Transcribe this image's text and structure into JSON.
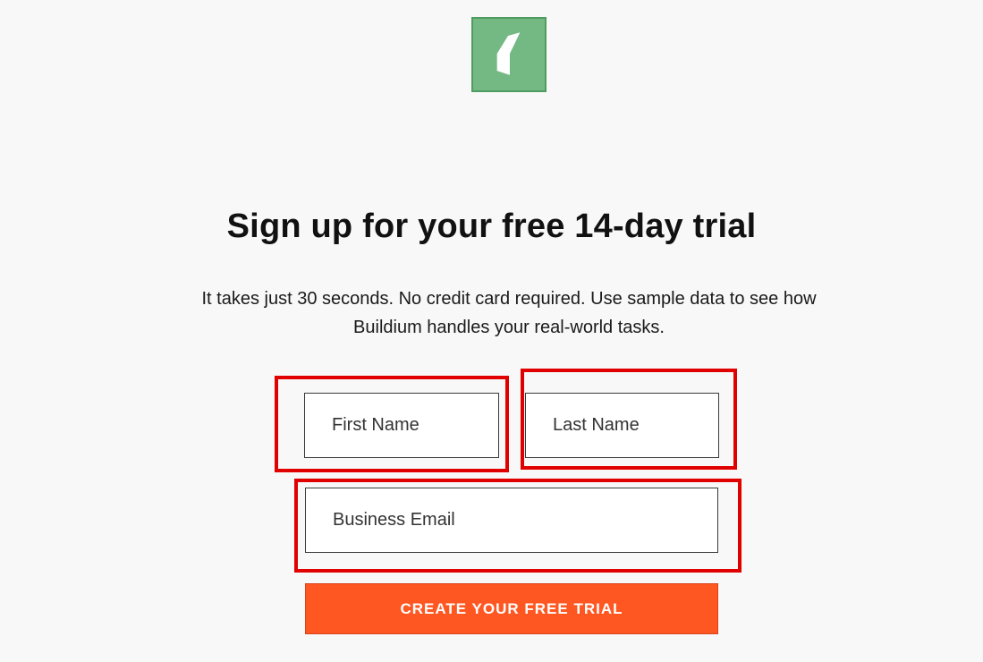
{
  "theme": {
    "brand_color": "#74b983",
    "accent_color": "#ff5722",
    "highlight_color": "#e00000",
    "background": "#f8f8f8"
  },
  "logo": {
    "icon": "buildium-logo-icon"
  },
  "signup": {
    "title": "Sign up for your free 14-day trial",
    "subtitle": "It takes just 30 seconds. No credit card required. Use sample data to see how Buildium handles your real-world tasks.",
    "fields": {
      "first_name": {
        "placeholder": "First Name",
        "value": ""
      },
      "last_name": {
        "placeholder": "Last Name",
        "value": ""
      },
      "email": {
        "placeholder": "Business Email",
        "value": ""
      }
    },
    "submit_label": "CREATE YOUR FREE TRIAL"
  }
}
